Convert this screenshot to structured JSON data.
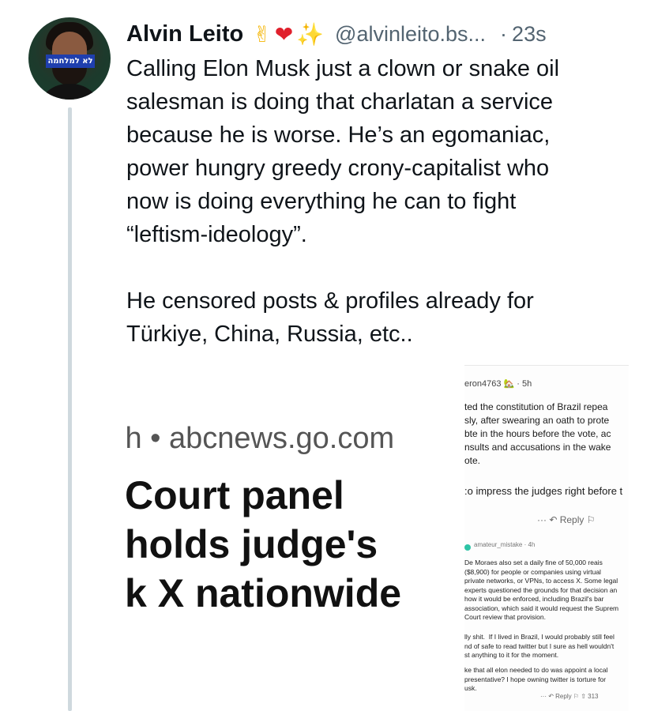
{
  "author": {
    "name": "Alvin Leito",
    "emojis": [
      "✌",
      "❤",
      "✨"
    ],
    "handle": "@alvinleito.bs...",
    "separator": "·",
    "time": "23s",
    "avatar_banner": "לא למלחמה"
  },
  "post": {
    "text": "Calling Elon Musk just a clown or snake oil\nsalesman is doing that charlatan a service\nbecause he is worse. He’s an egomaniac,\npower hungry greedy crony-capitalist who\nnow is doing everything he can to fight\n“leftism-ideology”.\n\nHe censored posts & profiles already for\nTürkiye, China, Russia, etc.."
  },
  "media": {
    "news_source": "ih • abcnews.go.com",
    "news_headline": "Court panel\nholds judge's\nk X nationwide",
    "comment_header": "eron4763 🏡 · 5h",
    "comment_body": "ted the constitution of Brazil repea\nsly, after swearing an oath to prote\nbte in the hours before the vote, ac\nnsults and accusations in the wake\note.",
    "comment_line2": ":o impress the judges right before t",
    "comment_actions": "···  ↶ Reply  ⚐",
    "reply_user": "amateur_mistake · 4h",
    "reply_body": "De Moraes also set a daily fine of 50,000 reais\n($8,900) for people or companies using virtual\nprivate networks, or VPNs, to access X. Some legal\nexperts questioned the grounds for that decision an\nhow it would be enforced, including Brazil's bar\nassociation, which said it would request the Suprem\nCourt review that provision.",
    "reply_body2": "lly shit.  If I lived in Brazil, I would probably still feel\nnd of safe to read twitter but I sure as hell wouldn't\nst anything to it for the moment.",
    "reply_body3": "ke that all elon needed to do was appoint a local\npresentative? I hope owning twitter is torture for\nusk.",
    "reply_actions": "···  ↶ Reply  ⚐  ⇧ 313"
  },
  "colors": {
    "text": "#0f1419",
    "secondary": "#536471",
    "thread_line": "#cfd9de"
  }
}
